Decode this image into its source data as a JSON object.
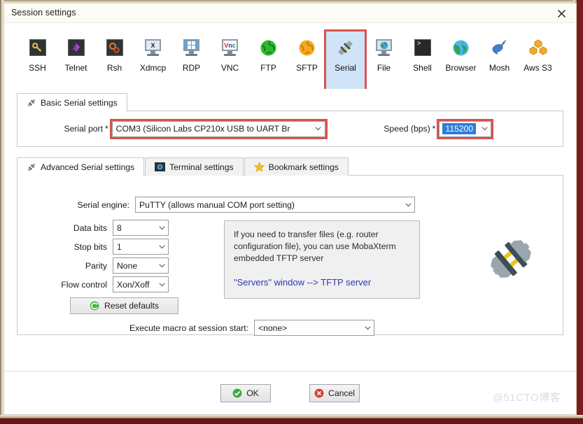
{
  "window": {
    "title": "Session settings",
    "close_icon": "close-icon",
    "accent_red": "#d9534f",
    "selection_blue": "#2a7fde",
    "selected_tab_bg": "#cfe4f7"
  },
  "session_types": [
    {
      "label": "SSH",
      "icon": "ssh-key-icon",
      "selected": false
    },
    {
      "label": "Telnet",
      "icon": "telnet-icon",
      "selected": false
    },
    {
      "label": "Rsh",
      "icon": "rsh-gears-icon",
      "selected": false
    },
    {
      "label": "Xdmcp",
      "icon": "xdmcp-monitor-icon",
      "selected": false
    },
    {
      "label": "RDP",
      "icon": "rdp-monitor-icon",
      "selected": false
    },
    {
      "label": "VNC",
      "icon": "vnc-monitor-icon",
      "selected": false
    },
    {
      "label": "FTP",
      "icon": "ftp-globe-icon",
      "selected": false
    },
    {
      "label": "SFTP",
      "icon": "sftp-globe-icon",
      "selected": false
    },
    {
      "label": "Serial",
      "icon": "serial-plug-icon",
      "selected": true
    },
    {
      "label": "File",
      "icon": "file-monitor-icon",
      "selected": false
    },
    {
      "label": "Shell",
      "icon": "shell-prompt-icon",
      "selected": false
    },
    {
      "label": "Browser",
      "icon": "browser-globe-icon",
      "selected": false
    },
    {
      "label": "Mosh",
      "icon": "mosh-dish-icon",
      "selected": false
    },
    {
      "label": "Aws S3",
      "icon": "aws-s3-icon",
      "selected": false
    }
  ],
  "basic_panel": {
    "tab_label": "Basic Serial settings",
    "tab_icon": "serial-plug-icon",
    "serial_port": {
      "label": "Serial port",
      "required_marker": "*",
      "value": "COM3   (Silicon Labs CP210x USB to UART Br",
      "highlighted": true
    },
    "speed": {
      "label": "Speed (bps)",
      "required_marker": "*",
      "value": "115200",
      "highlighted": true,
      "text_selected": true
    }
  },
  "advanced_panel": {
    "tabs": [
      {
        "label": "Advanced Serial settings",
        "icon": "serial-plug-icon",
        "active": true
      },
      {
        "label": "Terminal settings",
        "icon": "terminal-gear-icon",
        "active": false
      },
      {
        "label": "Bookmark settings",
        "icon": "star-icon",
        "active": false
      }
    ],
    "serial_engine": {
      "label": "Serial engine:",
      "value": "PuTTY   (allows manual COM port setting)"
    },
    "fields": [
      {
        "label": "Data bits",
        "value": "8"
      },
      {
        "label": "Stop bits",
        "value": "1"
      },
      {
        "label": "Parity",
        "value": "None"
      },
      {
        "label": "Flow control",
        "value": "Xon/Xoff"
      }
    ],
    "reset_button": {
      "label": "Reset defaults",
      "icon": "reset-circle-icon"
    },
    "info_box": {
      "text": "If you need to transfer files (e.g. router configuration file), you can use MobaXterm embedded TFTP server",
      "link_text": "\"Servers\" window  -->  TFTP server",
      "link_color": "#3333bb"
    },
    "decoration_icon": "serial-plug-large-icon",
    "macro": {
      "label": "Execute macro at session start:",
      "value": "<none>"
    }
  },
  "footer": {
    "ok": {
      "label": "OK",
      "icon": "check-circle-icon"
    },
    "cancel": {
      "label": "Cancel",
      "icon": "cancel-circle-icon"
    }
  },
  "watermark": {
    "text": "@51CTO博客"
  }
}
